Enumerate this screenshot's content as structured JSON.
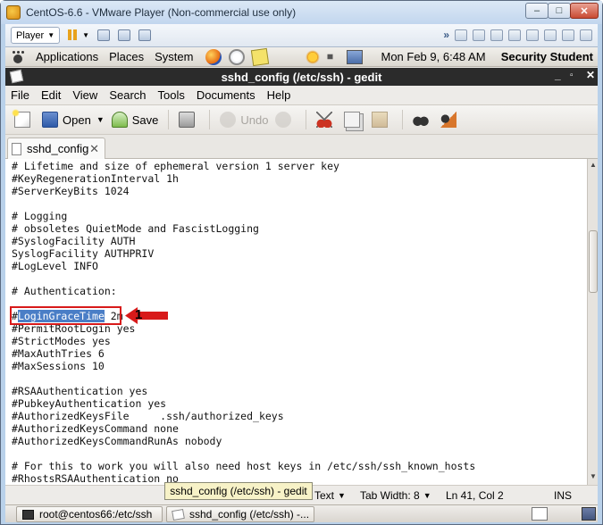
{
  "vmware": {
    "title": "CentOS-6.6 - VMware Player (Non-commercial use only)",
    "player_label": "Player",
    "controls": {
      "minimize": "–",
      "maximize": "□",
      "close": "✕"
    }
  },
  "gnome_panel": {
    "menus": [
      "Applications",
      "Places",
      "System"
    ],
    "clock": "Mon Feb  9,  6:48 AM",
    "user": "Security Student"
  },
  "gedit": {
    "title": "sshd_config (/etc/ssh) - gedit",
    "menus": [
      "File",
      "Edit",
      "View",
      "Search",
      "Tools",
      "Documents",
      "Help"
    ],
    "toolbar": {
      "open": "Open",
      "save": "Save",
      "undo": "Undo"
    },
    "tab": {
      "label": "sshd_config"
    },
    "lines": [
      "# Lifetime and size of ephemeral version 1 server key",
      "#KeyRegenerationInterval 1h",
      "#ServerKeyBits 1024",
      "",
      "# Logging",
      "# obsoletes QuietMode and FascistLogging",
      "#SyslogFacility AUTH",
      "SyslogFacility AUTHPRIV",
      "#LogLevel INFO",
      "",
      "# Authentication:",
      "",
      "",
      "#PermitRootLogin yes",
      "#StrictModes yes",
      "#MaxAuthTries 6",
      "#MaxSessions 10",
      "",
      "#RSAAuthentication yes",
      "#PubkeyAuthentication yes",
      "#AuthorizedKeysFile     .ssh/authorized_keys",
      "#AuthorizedKeysCommand none",
      "#AuthorizedKeysCommandRunAs nobody",
      "",
      "# For this to work you will also need host keys in /etc/ssh/ssh_known_hosts",
      "#RhostsRSAAuthentication no"
    ],
    "selected_line": {
      "prefix": "#",
      "selection": "LoginGraceTime",
      "suffix": " 2m"
    },
    "status": {
      "tooltip": "sshd_config (/etc/ssh) - gedit",
      "language": "Text",
      "tab_width": "Tab Width:  8",
      "position": "Ln 41, Col 2",
      "mode": "INS"
    }
  },
  "taskbar": {
    "items": [
      "root@centos66:/etc/ssh",
      "sshd_config (/etc/ssh) -..."
    ]
  },
  "annotation": {
    "number": "1",
    "color": "#d81a1a"
  }
}
